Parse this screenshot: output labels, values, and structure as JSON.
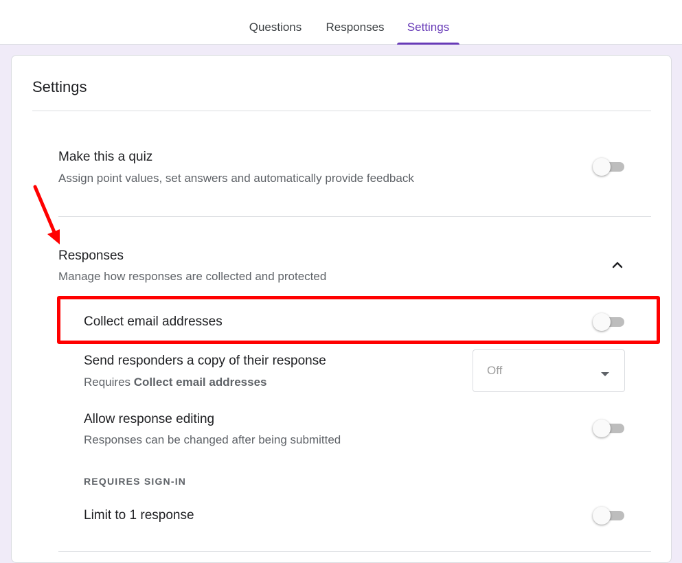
{
  "tabs": [
    {
      "label": "Questions",
      "active": false
    },
    {
      "label": "Responses",
      "active": false
    },
    {
      "label": "Settings",
      "active": true
    }
  ],
  "settings": {
    "title": "Settings",
    "quiz": {
      "title": "Make this a quiz",
      "subtitle": "Assign point values, set answers and automatically provide feedback",
      "enabled": false
    },
    "responses": {
      "title": "Responses",
      "subtitle": "Manage how responses are collected and protected",
      "expanded": true,
      "collect_email": {
        "label": "Collect email addresses",
        "enabled": false
      },
      "send_copy": {
        "label": "Send responders a copy of their response",
        "requires_prefix": "Requires ",
        "requires_bold": "Collect email addresses",
        "value": "Off"
      },
      "allow_editing": {
        "label": "Allow response editing",
        "subtitle": "Responses can be changed after being submitted",
        "enabled": false
      },
      "requires_signin_header": "REQUIRES SIGN-IN",
      "limit_one": {
        "label": "Limit to 1 response",
        "enabled": false
      }
    }
  },
  "annotations": {
    "highlight_color": "#ff0000",
    "arrow_color": "#ff0000"
  },
  "colors": {
    "accent": "#673ab7",
    "background": "#f0ebf8"
  }
}
